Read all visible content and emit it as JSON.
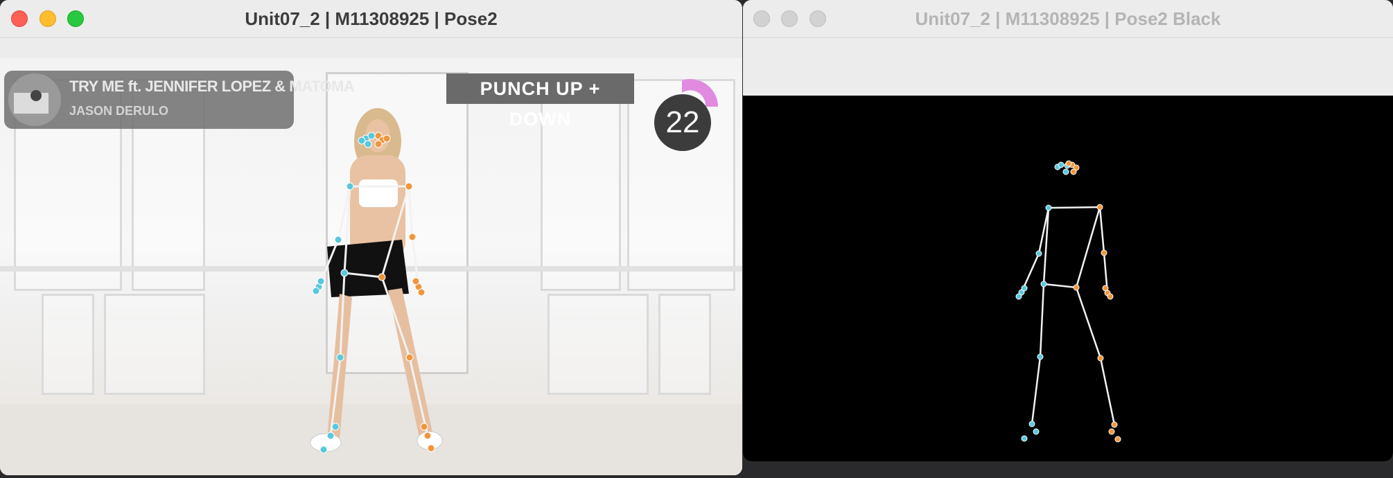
{
  "left_window": {
    "title": "Unit07_2 | M11308925 | Pose2",
    "traffic_lights": [
      "close",
      "minimize",
      "zoom"
    ],
    "video": {
      "song_title": "TRY ME ft. JENNIFER LOPEZ & MATOMA",
      "song_artist": "JASON DERULO",
      "move_name": "PUNCH UP + DOWN",
      "rep_counter": "22"
    }
  },
  "right_window": {
    "title": "Unit07_2 | M11308925 | Pose2 Black",
    "traffic_lights": [
      "close",
      "minimize",
      "zoom"
    ]
  },
  "colors": {
    "left_side_keypoint": "#5ac8dc",
    "right_side_keypoint": "#f0963c",
    "skeleton_line": "#f2f2f2",
    "close": "#fe5f57",
    "minimize": "#febc2e",
    "zoom": "#28c840",
    "inactive_light": "#d2d2d2",
    "counter_arc": "#e08be0"
  }
}
